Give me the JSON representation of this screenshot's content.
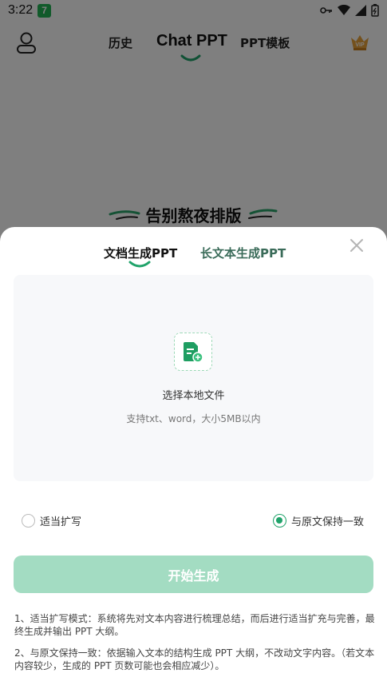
{
  "status_bar": {
    "time": "3:22",
    "app_badge": "7"
  },
  "nav": {
    "history": "历史",
    "title": "Chat PPT",
    "template": "PPT模板",
    "vip": "VIP"
  },
  "hero": {
    "title": "告别熬夜排版"
  },
  "sheet": {
    "tabs": [
      {
        "label": "文档生成PPT",
        "active": true
      },
      {
        "label": "长文本生成PPT",
        "active": false
      }
    ],
    "upload": {
      "title": "选择本地文件",
      "hint": "支持txt、word，大小5MB以内"
    },
    "options": [
      {
        "label": "适当扩写",
        "checked": false
      },
      {
        "label": "与原文保持一致",
        "checked": true
      }
    ],
    "start_button": "开始生成",
    "notes": [
      "1、适当扩写模式：系统将先对文本内容进行梳理总结，而后进行适当扩充与完善，最终生成并输出 PPT 大纲。",
      "2、与原文保持一致：依据输入文本的结构生成 PPT 大纲，不改动文字内容。（若文本内容较少，生成的 PPT 页数可能也会相应减少）。"
    ]
  },
  "colors": {
    "accent": "#20a36a",
    "button_disabled": "#a3dcc2",
    "tab_inactive": "#3a6b59"
  }
}
